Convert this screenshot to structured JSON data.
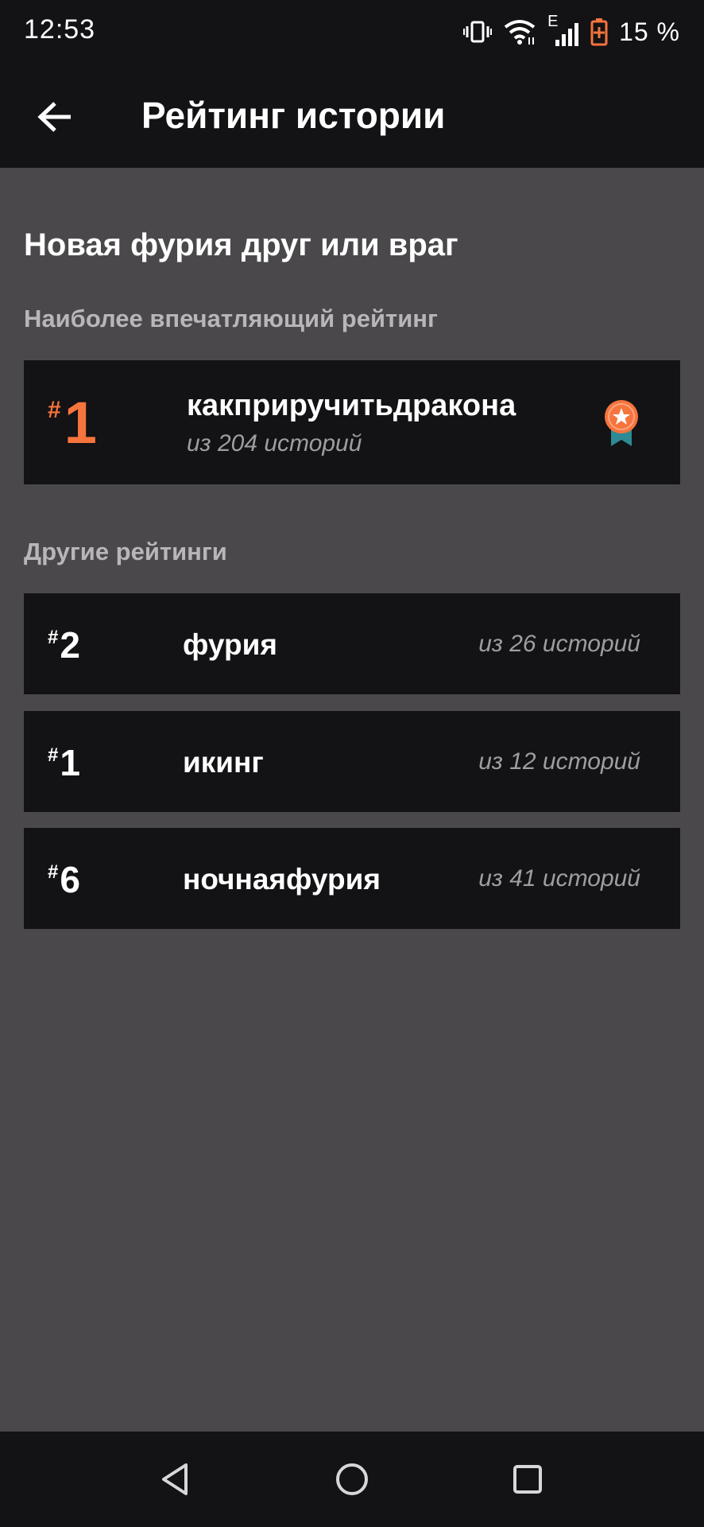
{
  "status_bar": {
    "time": "12:53",
    "network_type": "E",
    "battery_percent": "15 %"
  },
  "app_bar": {
    "title": "Рейтинг истории"
  },
  "story": {
    "title": "Новая фурия друг или враг"
  },
  "top_ranking": {
    "section_label": "Наиболее впечатляющий рейтинг",
    "hash": "#",
    "rank": "1",
    "tag": "какприручитьдракона",
    "count_text": "из 204 историй",
    "rank_color": "#f6743d"
  },
  "other_rankings": {
    "section_label": "Другие рейтинги",
    "items": [
      {
        "hash": "#",
        "rank": "2",
        "tag": "фурия",
        "count_text": "из 26 историй"
      },
      {
        "hash": "#",
        "rank": "1",
        "tag": "икинг",
        "count_text": "из 12 историй"
      },
      {
        "hash": "#",
        "rank": "6",
        "tag": "ночнаяфурия",
        "count_text": "из 41 историй"
      }
    ]
  },
  "icons": {
    "back": "arrow-left-icon",
    "medal": "medal-star-icon",
    "nav_back": "triangle-back-icon",
    "nav_home": "circle-home-icon",
    "nav_recents": "square-recents-icon"
  },
  "colors": {
    "background": "#4a484b",
    "bars": "#131215",
    "accent": "#f6743d",
    "medal_ribbon": "#2e8a94"
  }
}
